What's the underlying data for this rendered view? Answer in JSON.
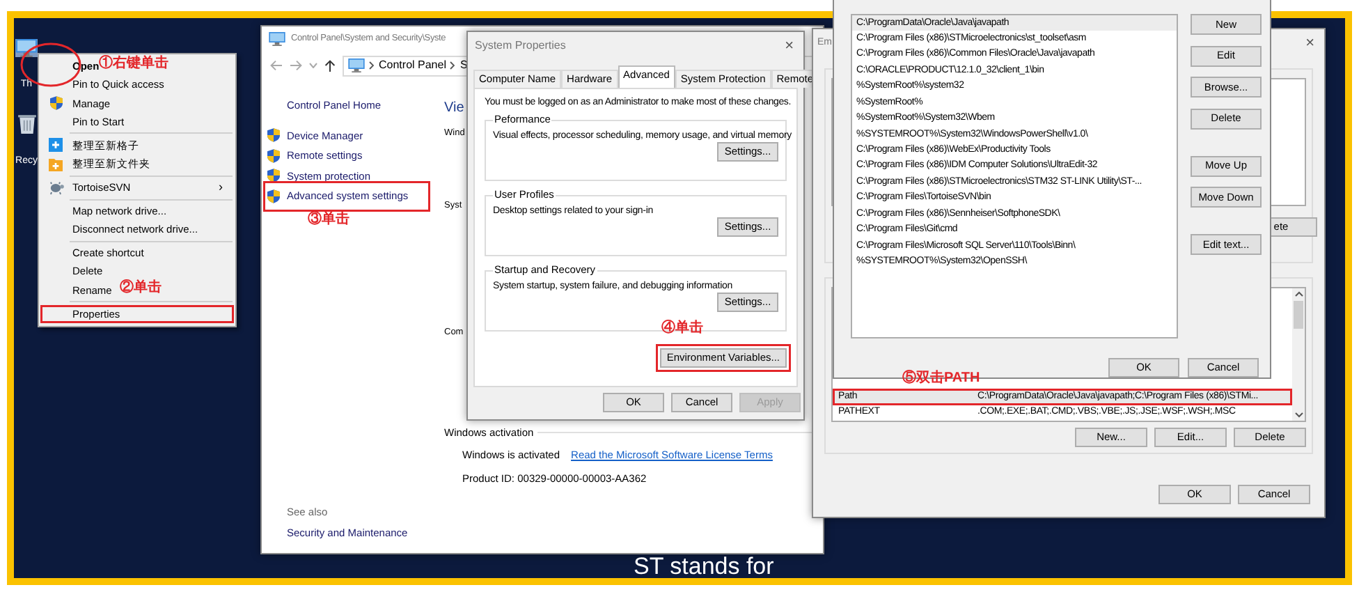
{
  "desktop": {
    "icons": [
      {
        "kind": "computer",
        "label": "Th",
        "annotated": true
      },
      {
        "kind": "recycle_bin",
        "label": "Recy",
        "annotated": false
      }
    ],
    "background_text": "ST stands for"
  },
  "context_menu": {
    "items": [
      {
        "kind": "default",
        "label": "Open",
        "annotated": false
      },
      {
        "kind": "item",
        "label": "Pin to Quick access",
        "annotated": false
      },
      {
        "kind": "item",
        "label": "Manage",
        "annotated": false
      },
      {
        "kind": "item",
        "label": "Pin to Start",
        "annotated": false
      },
      {
        "kind": "separator"
      },
      {
        "kind": "item",
        "label": "整理至新格子",
        "annotated": false
      },
      {
        "kind": "item",
        "label": "整理至新文件夹",
        "annotated": false
      },
      {
        "kind": "separator"
      },
      {
        "kind": "submenu",
        "label": "TortoiseSVN",
        "annotated": false,
        "arrow": "›"
      },
      {
        "kind": "separator"
      },
      {
        "kind": "item",
        "label": "Map network drive...",
        "annotated": false
      },
      {
        "kind": "item",
        "label": "Disconnect network drive...",
        "annotated": false
      },
      {
        "kind": "separator"
      },
      {
        "kind": "item",
        "label": "Create shortcut",
        "annotated": false
      },
      {
        "kind": "item",
        "label": "Delete",
        "annotated": false
      },
      {
        "kind": "item",
        "label": "Rename",
        "annotated": false
      },
      {
        "kind": "separator"
      },
      {
        "kind": "item",
        "label": "Properties",
        "annotated": true
      }
    ]
  },
  "control_panel": {
    "title": "Control Panel\\System and Security\\Syste",
    "breadcrumb": [
      "Control Panel",
      "S"
    ],
    "home_link": "Control Panel Home",
    "tasks": [
      {
        "label": "Device Manager",
        "annotated": false
      },
      {
        "label": "Remote settings",
        "annotated": false
      },
      {
        "label": "System protection",
        "annotated": false
      },
      {
        "label": "Advanced system settings",
        "annotated": true
      }
    ],
    "see_also": {
      "heading": "See also",
      "links": [
        "Security and Maintenance"
      ]
    },
    "main_fragments": [
      "Vie",
      "Wind",
      "Syst",
      "Com"
    ],
    "activation": {
      "heading": "Windows activation",
      "status": "Windows is activated",
      "link": "Read the Microsoft Software License Terms",
      "product_id": "Product ID: 00329-00000-00003-AA362"
    }
  },
  "system_properties": {
    "title": "System Properties",
    "close": "×",
    "tabs": [
      {
        "label": "Computer Name",
        "selected": false
      },
      {
        "label": "Hardware",
        "selected": false
      },
      {
        "label": "Advanced",
        "selected": true
      },
      {
        "label": "System Protection",
        "selected": false
      },
      {
        "label": "Remote",
        "selected": false
      }
    ],
    "notice": "You must be logged on as an Administrator to make most of these changes.",
    "groups": [
      {
        "title": "Peformance",
        "description": "Visual effects, processor scheduling, memory usage, and virtual memory",
        "button": "Settings..."
      },
      {
        "title": "User Profiles",
        "description": "Desktop settings related to your sign-in",
        "button": "Settings..."
      },
      {
        "title": "Startup and Recovery",
        "description": "System startup, system failure, and debugging information",
        "button": "Settings..."
      }
    ],
    "env_button": {
      "label": "Environment Variables...",
      "annotated": true
    },
    "footer_buttons": [
      {
        "label": "OK",
        "disabled": false
      },
      {
        "label": "Cancel",
        "disabled": false
      },
      {
        "label": "Apply",
        "disabled": true
      }
    ]
  },
  "environment_variables": {
    "title": "Em",
    "close": "×",
    "user_button_fragment": "ete",
    "system_variables": [
      {
        "name": "Path",
        "value": "C:\\ProgramData\\Oracle\\Java\\javapath;C:\\Program Files (x86)\\STMi...",
        "selected": true,
        "annotated": true
      },
      {
        "name": "PATHEXT",
        "value": ".COM;.EXE;.BAT;.CMD;.VBS;.VBE;.JS;.JSE;.WSF;.WSH;.MSC",
        "selected": false,
        "annotated": false
      }
    ],
    "system_buttons": [
      "New...",
      "Edit...",
      "Delete"
    ],
    "footer_buttons": [
      "OK",
      "Cancel"
    ]
  },
  "edit_path": {
    "entries": [
      {
        "text": "C:\\ProgramData\\Oracle\\Java\\javapath",
        "selected": true
      },
      {
        "text": "C:\\Program Files (x86)\\STMicroelectronics\\st_toolset\\asm",
        "selected": false
      },
      {
        "text": "C:\\Program Files (x86)\\Common Files\\Oracle\\Java\\javapath",
        "selected": false
      },
      {
        "text": "C:\\ORACLE\\PRODUCT\\12.1.0_32\\client_1\\bin",
        "selected": false
      },
      {
        "text": "%SystemRoot%\\system32",
        "selected": false
      },
      {
        "text": "%SystemRoot%",
        "selected": false
      },
      {
        "text": "%SystemRoot%\\System32\\Wbem",
        "selected": false
      },
      {
        "text": "%SYSTEMROOT%\\System32\\WindowsPowerShell\\v1.0\\",
        "selected": false
      },
      {
        "text": "C:\\Program Files (x86)\\WebEx\\Productivity Tools",
        "selected": false
      },
      {
        "text": "C:\\Program Files (x86)\\IDM Computer Solutions\\UltraEdit-32",
        "selected": false
      },
      {
        "text": "C:\\Program Files (x86)\\STMicroelectronics\\STM32 ST-LINK Utility\\ST-...",
        "selected": false
      },
      {
        "text": "C:\\Program Files\\TortoiseSVN\\bin",
        "selected": false
      },
      {
        "text": "C:\\Program Files (x86)\\Sennheiser\\SoftphoneSDK\\",
        "selected": false
      },
      {
        "text": "C:\\Program Files\\Git\\cmd",
        "selected": false
      },
      {
        "text": "C:\\Program Files\\Microsoft SQL Server\\110\\Tools\\Binn\\",
        "selected": false
      },
      {
        "text": "%SYSTEMROOT%\\System32\\OpenSSH\\",
        "selected": false
      }
    ],
    "button_groups": [
      [
        "New",
        "Edit",
        "Browse...",
        "Delete"
      ],
      [
        "Move Up",
        "Move Down"
      ],
      [
        "Edit text..."
      ]
    ],
    "footer_buttons": [
      "OK",
      "Cancel"
    ]
  },
  "annotations": [
    {
      "text": "①右键单击"
    },
    {
      "text": "②单击"
    },
    {
      "text": "③单击"
    },
    {
      "text": "④单击"
    },
    {
      "text": "⑤双击PATH"
    }
  ]
}
